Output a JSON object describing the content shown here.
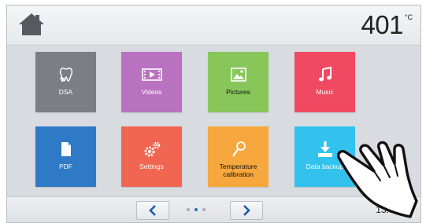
{
  "header": {
    "home_icon": "home-icon",
    "temperature": "401",
    "temperature_unit": "°C"
  },
  "tiles": [
    {
      "label": "DSA",
      "color": "#7b7f84",
      "icon": "tooth-icon"
    },
    {
      "label": "Videos",
      "color": "#b972c0",
      "icon": "film-icon"
    },
    {
      "label": "Pictures",
      "color": "#88c65a",
      "icon": "picture-icon"
    },
    {
      "label": "Music",
      "color": "#ef4a61",
      "icon": "music-note-icon"
    },
    {
      "label": "PDF",
      "color": "#2e7ac7",
      "icon": "document-icon"
    },
    {
      "label": "Settings",
      "color": "#f06652",
      "icon": "gears-icon"
    },
    {
      "label": "Temperature calibration",
      "color": "#f6a83e",
      "icon": "calibration-icon"
    },
    {
      "label": "Data backup",
      "color": "#33c2ee",
      "icon": "download-icon"
    }
  ],
  "footer": {
    "prev_icon": "chevron-left-icon",
    "next_icon": "chevron-right-icon",
    "page_dots": 3,
    "active_page": 2,
    "time": "13:59:26"
  },
  "overlay": {
    "hand_icon": "pointing-hand-icon"
  },
  "colors": {
    "accent_blue": "#2f6fb7",
    "header_bg": "#eef0f2",
    "content_bg": "#d8dce0"
  }
}
